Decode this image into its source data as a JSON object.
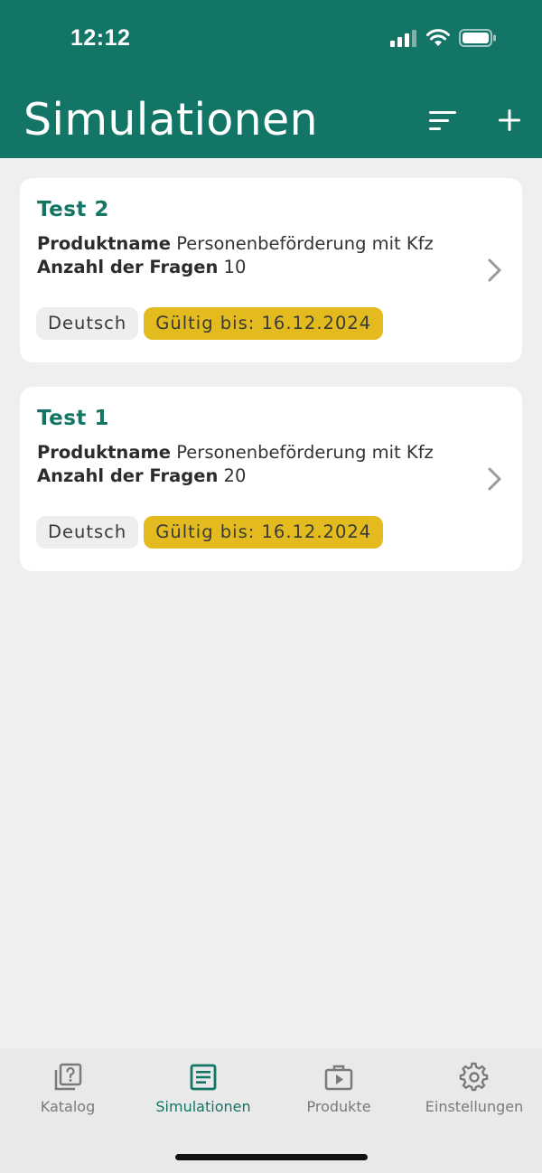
{
  "status": {
    "time": "12:12"
  },
  "header": {
    "title": "Simulationen"
  },
  "colors": {
    "primary": "#137566",
    "valid_chip": "#e3bb1e",
    "background": "#efefef"
  },
  "labels": {
    "product": "Produktname",
    "questions": "Anzahl der Fragen"
  },
  "cards": [
    {
      "title": "Test 2",
      "product_value": "Personenbeförderung mit Kfz",
      "questions_value": "10",
      "language": "Deutsch",
      "valid": "Gültig bis: 16.12.2024"
    },
    {
      "title": "Test 1",
      "product_value": "Personenbeförderung mit Kfz",
      "questions_value": "20",
      "language": "Deutsch",
      "valid": "Gültig bis: 16.12.2024"
    }
  ],
  "tabs": [
    {
      "label": "Katalog",
      "icon": "question-catalog-icon"
    },
    {
      "label": "Simulationen",
      "icon": "document-list-icon",
      "active": true
    },
    {
      "label": "Produkte",
      "icon": "play-briefcase-icon"
    },
    {
      "label": "Einstellungen",
      "icon": "gear-icon"
    }
  ]
}
